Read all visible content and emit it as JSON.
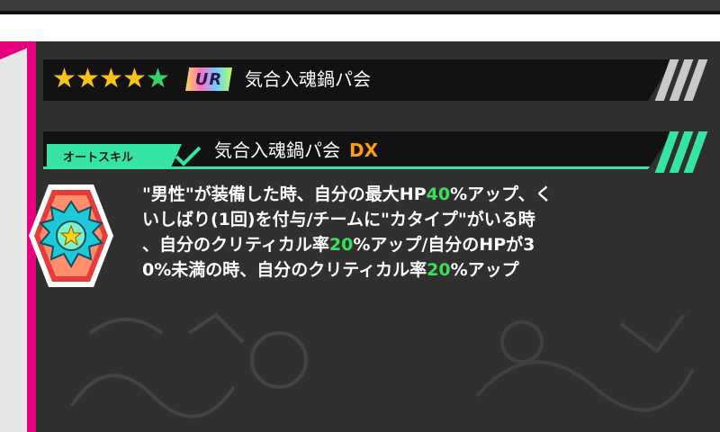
{
  "equipment": {
    "rarity_stars": {
      "gold": 4,
      "green": 1
    },
    "rank": "UR",
    "name": "気合入魂鍋パ会"
  },
  "skill": {
    "tag_label": "オートスキル",
    "name": "気合入魂鍋パ会",
    "suffix": "DX",
    "description_lines": [
      [
        "\"男性\"が装備した時、自分の最大HP",
        "40",
        "%アップ、く"
      ],
      [
        "いしばり(1回)を付与/チームに\"カタイプ\"がいる時"
      ],
      [
        "、自分のクリティカル率",
        "20",
        "%アップ/自分のHPが3"
      ],
      [
        "0%未満の時、自分のクリティカル率",
        "20",
        "%アップ"
      ]
    ]
  },
  "colors": {
    "accent_pink": "#e6007e",
    "accent_green": "#35e5a2",
    "highlight_green": "#39e05a",
    "dx_orange": "#ff9a1a",
    "star_gold": "#f7c21b",
    "star_green": "#38d46a"
  },
  "icons": {
    "star": "star-icon",
    "skill_emblem": "skill-emblem-icon",
    "check": "check-mark-icon"
  }
}
